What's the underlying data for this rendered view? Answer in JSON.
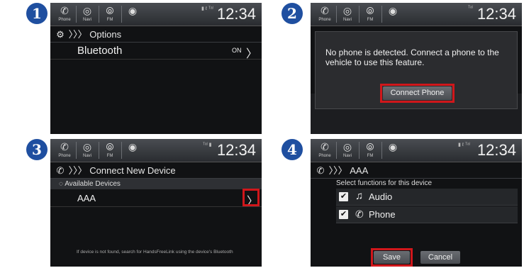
{
  "status": {
    "nav": [
      {
        "icon": "phone-icon",
        "label": "Phone"
      },
      {
        "icon": "navi-icon",
        "label": "Navi"
      },
      {
        "icon": "fm-icon",
        "label": "FM"
      }
    ],
    "time": "12:34"
  },
  "steps": [
    "1",
    "2",
    "3",
    "4"
  ],
  "panel1": {
    "header": "Options",
    "row_label": "Bluetooth",
    "row_value": "ON"
  },
  "panel2": {
    "message": "No phone is detected. Connect a phone to the vehicle to use this feature.",
    "button": "Connect Phone"
  },
  "panel3": {
    "header": "Connect New Device",
    "subheader": "Available Devices",
    "device": "AAA",
    "footer": "If device is not found, search for HandsFreeLink using the device's Bluetooth"
  },
  "panel4": {
    "header": "AAA",
    "subheader": "Select functions for this device",
    "functions": [
      "Audio",
      "Phone"
    ],
    "save": "Save",
    "cancel": "Cancel"
  },
  "colors": {
    "highlight": "#d0171b",
    "badge": "#1f4fa0",
    "screen": "#111214"
  }
}
